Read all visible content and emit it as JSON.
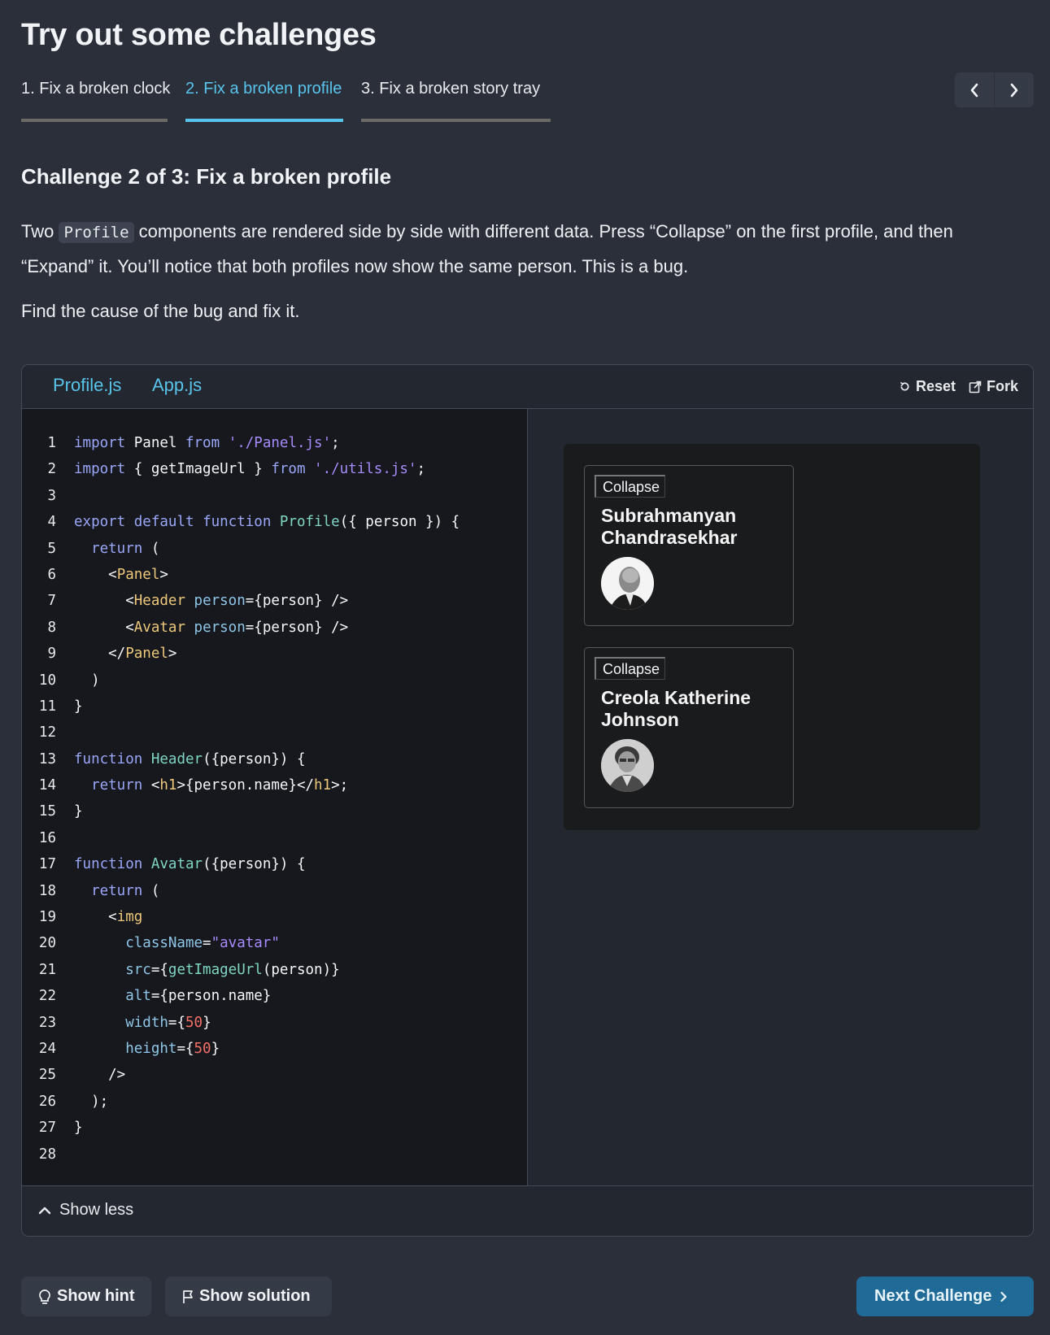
{
  "page": {
    "title": "Try out some challenges"
  },
  "challenge_tabs": [
    {
      "label": "1. Fix a broken clock",
      "active": false
    },
    {
      "label": "2. Fix a broken profile",
      "active": true
    },
    {
      "label": "3. Fix a broken story tray",
      "active": false
    }
  ],
  "nav": {
    "prev_icon": "chevron-left-icon",
    "next_icon": "chevron-right-icon"
  },
  "challenge": {
    "heading_prefix": "Challenge 2 of 3:",
    "heading_title": "Fix a broken profile",
    "desc_before_code": "Two ",
    "desc_code": "Profile",
    "desc_after_code": " components are rendered side by side with different data. Press “Collapse” on the first profile, and then “Expand” it. You’ll notice that both profiles now show the same person. This is a bug.",
    "desc_second": "Find the cause of the bug and fix it."
  },
  "sandbox": {
    "file_tabs": [
      "Profile.js",
      "App.js"
    ],
    "active_file": "Profile.js",
    "actions": {
      "reset": "Reset",
      "fork": "Fork"
    },
    "show_less": "Show less",
    "code_lines": [
      "import Panel from './Panel.js';",
      "import { getImageUrl } from './utils.js';",
      "",
      "export default function Profile({ person }) {",
      "  return (",
      "    <Panel>",
      "      <Header person={person} />",
      "      <Avatar person={person} />",
      "    </Panel>",
      "  )",
      "}",
      "",
      "function Header({person}) {",
      "  return <h1>{person.name}</h1>;",
      "}",
      "",
      "function Avatar({person}) {",
      "  return (",
      "    <img",
      "      className=\"avatar\"",
      "      src={getImageUrl(person)}",
      "      alt={person.name}",
      "      width={50}",
      "      height={50}",
      "    />",
      "  );",
      "}",
      ""
    ],
    "preview": {
      "cards": [
        {
          "button": "Collapse",
          "name": "Subrahmanyan Chandrasekhar"
        },
        {
          "button": "Collapse",
          "name": "Creola Katherine Johnson"
        }
      ]
    }
  },
  "footer": {
    "hint": "Show hint",
    "solution": "Show solution",
    "next": "Next Challenge"
  }
}
